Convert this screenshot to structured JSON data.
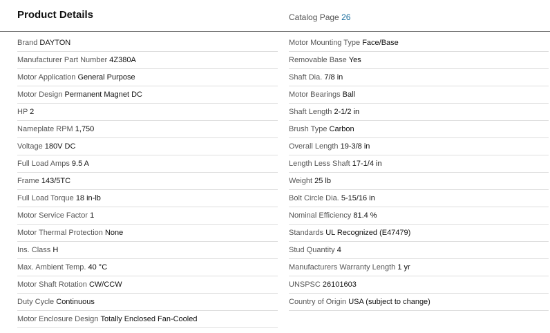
{
  "header": {
    "title": "Product Details",
    "catalog_label": "Catalog Page",
    "catalog_value": "26"
  },
  "left": [
    {
      "label": "Brand",
      "value": "DAYTON"
    },
    {
      "label": "Manufacturer Part Number",
      "value": "4Z380A"
    },
    {
      "label": "Motor Application",
      "value": "General Purpose"
    },
    {
      "label": "Motor Design",
      "value": "Permanent Magnet DC"
    },
    {
      "label": "HP",
      "value": "2"
    },
    {
      "label": "Nameplate RPM",
      "value": "1,750"
    },
    {
      "label": "Voltage",
      "value": "180V DC"
    },
    {
      "label": "Full Load Amps",
      "value": "9.5 A"
    },
    {
      "label": "Frame",
      "value": "143/5TC"
    },
    {
      "label": "Full Load Torque",
      "value": "18 in-lb"
    },
    {
      "label": "Motor Service Factor",
      "value": "1"
    },
    {
      "label": "Motor Thermal Protection",
      "value": "None"
    },
    {
      "label": "Ins. Class",
      "value": "H"
    },
    {
      "label": "Max. Ambient Temp.",
      "value": "40 °C"
    },
    {
      "label": "Motor Shaft Rotation",
      "value": "CW/CCW"
    },
    {
      "label": "Duty Cycle",
      "value": "Continuous"
    },
    {
      "label": "Motor Enclosure Design",
      "value": "Totally Enclosed Fan-Cooled"
    }
  ],
  "right": [
    {
      "label": "Motor Mounting Type",
      "value": "Face/Base"
    },
    {
      "label": "Removable Base",
      "value": "Yes"
    },
    {
      "label": "Shaft Dia.",
      "value": "7/8 in"
    },
    {
      "label": "Motor Bearings",
      "value": "Ball"
    },
    {
      "label": "Shaft Length",
      "value": "2-1/2 in"
    },
    {
      "label": "Brush Type",
      "value": "Carbon"
    },
    {
      "label": "Overall Length",
      "value": "19-3/8 in"
    },
    {
      "label": "Length Less Shaft",
      "value": "17-1/4 in"
    },
    {
      "label": "Weight",
      "value": "25 lb"
    },
    {
      "label": "Bolt Circle Dia.",
      "value": "5-15/16 in"
    },
    {
      "label": "Nominal Efficiency",
      "value": "81.4 %"
    },
    {
      "label": "Standards",
      "value": "UL Recognized (E47479)"
    },
    {
      "label": "Stud Quantity",
      "value": "4"
    },
    {
      "label": "Manufacturers Warranty Length",
      "value": "1 yr"
    },
    {
      "label": "UNSPSC",
      "value": "26101603"
    },
    {
      "label": "Country of Origin",
      "value": "USA (subject to change)"
    }
  ]
}
